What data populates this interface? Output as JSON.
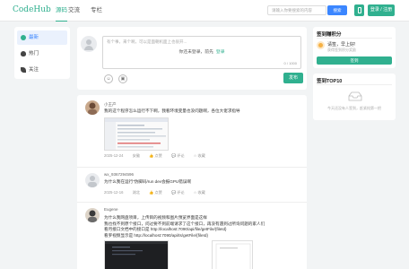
{
  "header": {
    "logo": "CodeHub",
    "nav": [
      "源码",
      "交流",
      "专栏"
    ],
    "search_placeholder": "请输入你要搜索的内容",
    "search_btn": "搜索",
    "login_btn": "登录 / 注册"
  },
  "menu": {
    "items": [
      "最新",
      "热门",
      "关注"
    ]
  },
  "editor": {
    "placeholder": "有个事，来个啊，可以是面朝机面上也很开...",
    "login_hint": "你还未登录，前先",
    "login_link": "登录",
    "char_count": "0 / 1000",
    "publish": "发布"
  },
  "posts": [
    {
      "name": "小王产",
      "text": "我的这个程序怎么运行不下啊，我看环境变量也没问题啊，各位大佬求指导",
      "meta": [
        "2025-12-24",
        "安徽",
        "点赞",
        "评论",
        "收藏"
      ]
    },
    {
      "name": "wx_9367294596",
      "text": "为什么我在运行“伪脚码/run dev会报GPU错误啊",
      "meta": [
        "2025-12-16",
        "湖北",
        "点赞",
        "评论",
        "收藏"
      ]
    },
    {
      "name": "Eugene",
      "lines": [
        "为什么我网盘项目，上传目的视频和图片预览界面是这样",
        "我也找不到原个接口，问过要不到前端请求了这个接口，再没有遇到过所询问题的家人们",
        "看月接口文档中的接口是 http://localhost:7090/api/file/getFile/{fileId}",
        "看罗视频显示是 http://localhost:7090/api/ts/getFile/{fileId}"
      ]
    }
  ],
  "side_sign": {
    "title": "签到赚积分",
    "sign_title": "请签，早上好!",
    "sign_sub": "获得签到积分奖励",
    "btn": "签到"
  },
  "side_top": {
    "title": "签到TOP10",
    "empty": "今天还没有人签到，赶紧抢第一把"
  },
  "colors": {
    "brand": "#30b08f",
    "accent": "#3b86ff"
  }
}
